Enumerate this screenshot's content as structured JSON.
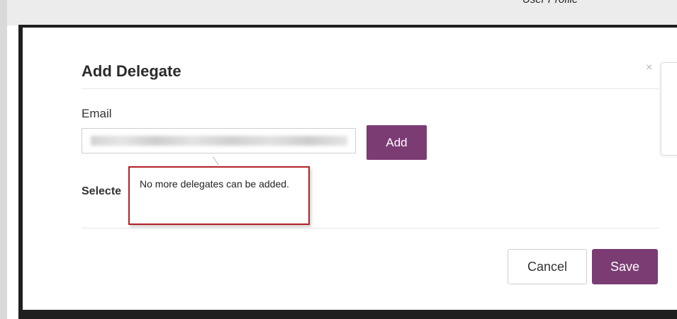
{
  "page": {
    "top_right_label": "User Profile"
  },
  "dialog": {
    "title": "Add Delegate",
    "close_glyph": "×",
    "email_label": "Email",
    "email_value": "",
    "add_label": "Add",
    "selected_label": "Selecte",
    "tooltip_message": "No more delegates can be added.",
    "cancel_label": "Cancel",
    "save_label": "Save"
  },
  "colors": {
    "accent": "#7b3c74",
    "highlight_border": "#b42025"
  },
  "icons": {
    "close": "close-icon"
  }
}
